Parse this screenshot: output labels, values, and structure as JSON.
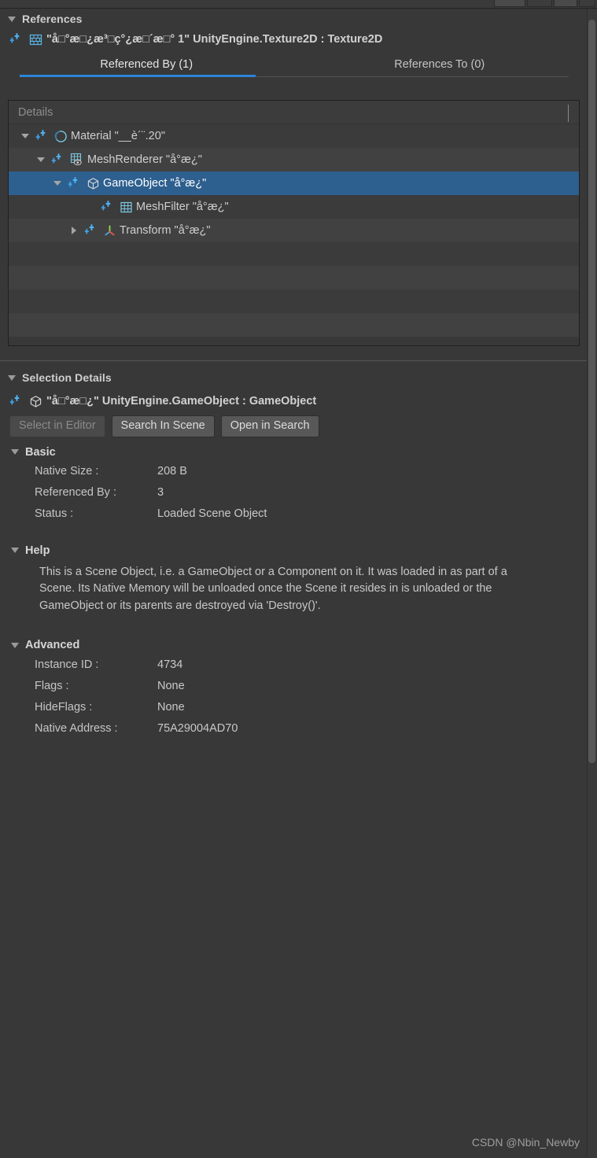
{
  "window": {
    "background_color": "#383838",
    "accent_color": "#2c84d8",
    "selection_color": "#2d5f8f"
  },
  "toolbar": {
    "chips": [
      "chip-1",
      "chip-2",
      "chip-3",
      "chip-4"
    ]
  },
  "references_panel": {
    "header": "References",
    "object": {
      "icon": "texture2d-icon",
      "ref_icon": "sparkle-icon",
      "label": "\"å□°æ□¿æ³□ç°¿æ□´æ□° 1\" UnityEngine.Texture2D : Texture2D"
    },
    "tabs": [
      {
        "label": "Referenced By (1)",
        "active": true
      },
      {
        "label": "References To (0)",
        "active": false
      }
    ],
    "tree": {
      "column_header": "Details",
      "rows": [
        {
          "depth": 0,
          "expander": "down",
          "ref_icon": "sparkle-icon",
          "type_icon": "material-icon",
          "label": "Material \"__è´¨.20\"",
          "selected": false
        },
        {
          "depth": 1,
          "expander": "down",
          "ref_icon": "sparkle-icon",
          "type_icon": "meshrenderer-icon",
          "label": "MeshRenderer \"å°æ¿\"",
          "selected": false
        },
        {
          "depth": 2,
          "expander": "down",
          "ref_icon": "sparkle-icon",
          "type_icon": "gameobject-icon",
          "label": "GameObject \"å°æ¿\"",
          "selected": true
        },
        {
          "depth": 3,
          "expander": "none",
          "ref_icon": "sparkle-icon",
          "type_icon": "meshfilter-icon",
          "label": "MeshFilter \"å°æ¿\"",
          "selected": false
        },
        {
          "depth": 2,
          "expander": "right",
          "ref_icon": "sparkle-icon",
          "type_icon": "transform-icon",
          "label": "Transform \"å°æ¿\"",
          "selected": false
        }
      ],
      "empty_row_count": 4
    }
  },
  "selection_details_panel": {
    "header": "Selection Details",
    "object": {
      "icon": "gameobject-icon",
      "ref_icon": "sparkle-icon",
      "label": "\"å□°æ□¿\" UnityEngine.GameObject : GameObject"
    },
    "buttons": [
      {
        "label": "Select in Editor",
        "disabled": true
      },
      {
        "label": "Search In Scene",
        "disabled": false
      },
      {
        "label": "Open in Search",
        "disabled": false
      }
    ],
    "basic": {
      "title": "Basic",
      "rows": [
        {
          "key": "Native Size :",
          "value": "208 B"
        },
        {
          "key": "Referenced By :",
          "value": "3"
        },
        {
          "key": "Status :",
          "value": "Loaded Scene Object"
        }
      ]
    },
    "help": {
      "title": "Help",
      "text": "This is a Scene Object, i.e. a GameObject or a Component on it. It was loaded in as part of a Scene. Its Native Memory will be unloaded once the Scene it resides in is unloaded or the GameObject or its parents are destroyed via 'Destroy()'."
    },
    "advanced": {
      "title": "Advanced",
      "rows": [
        {
          "key": "Instance ID :",
          "value": "4734"
        },
        {
          "key": "Flags :",
          "value": "None"
        },
        {
          "key": "HideFlags :",
          "value": "None"
        },
        {
          "key": "Native Address :",
          "value": "75A29004AD70"
        }
      ]
    }
  },
  "watermark": "CSDN @Nbin_Newby"
}
